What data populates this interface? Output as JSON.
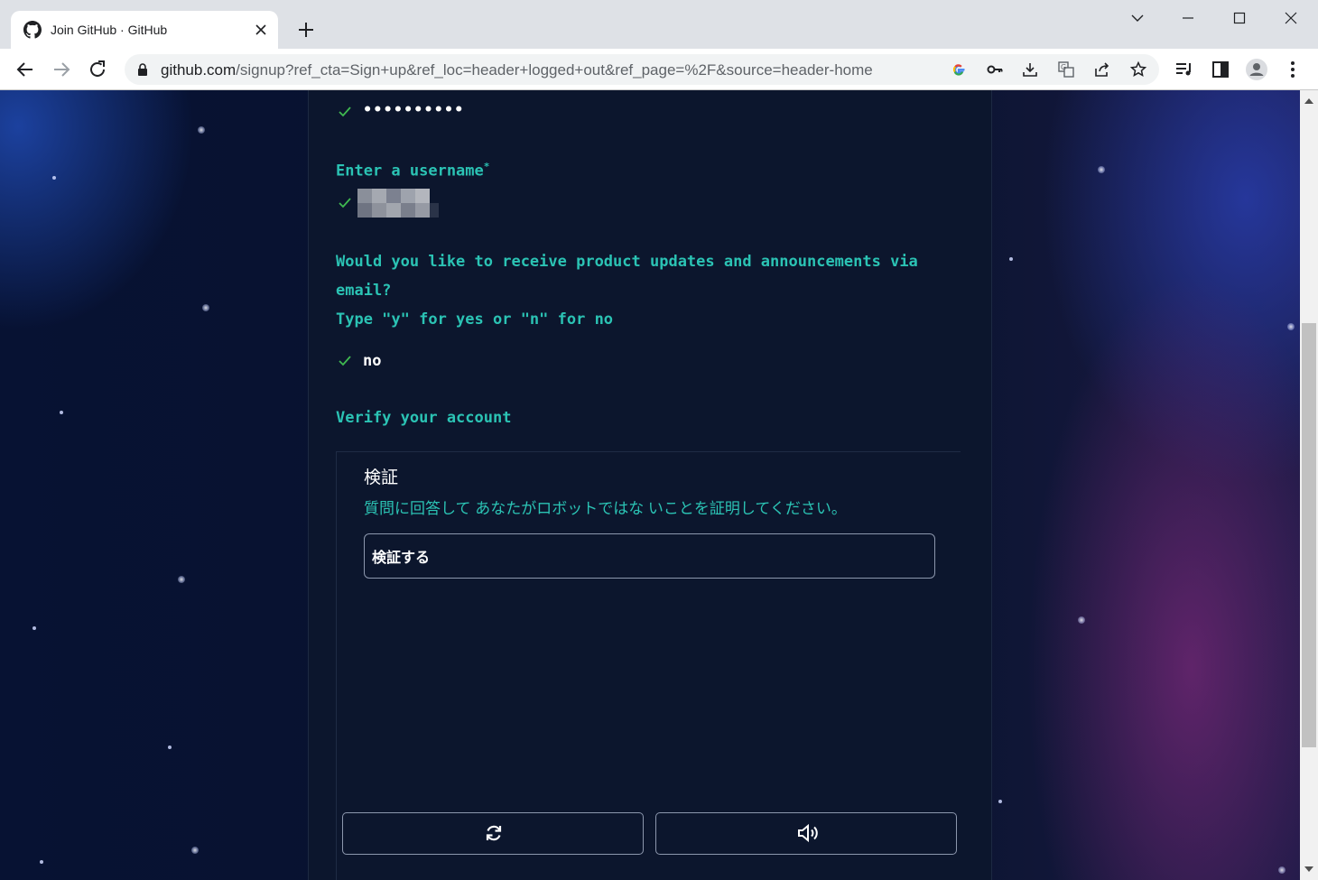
{
  "browser": {
    "tab_title": "Join GitHub · GitHub",
    "url_host": "github.com",
    "url_path": "/signup?ref_cta=Sign+up&ref_loc=header+logged+out&ref_page=%2F&source=header-home"
  },
  "form": {
    "password_value": "••••••••••",
    "username_label": "Enter a username",
    "username_required_mark": "*",
    "email_question_line1": "Would you like to receive product updates and announcements via",
    "email_question_line2": "email?",
    "email_question_line3": "Type \"y\" for yes or \"n\" for no",
    "email_answer": "no",
    "verify_heading": "Verify your account"
  },
  "captcha": {
    "title": "検証",
    "description": "質問に回答して あなたがロボットではな いことを証明してください。",
    "button_label": "検証する",
    "reload_icon": "reload-icon",
    "audio_icon": "speaker-icon"
  },
  "colors": {
    "accent_teal": "#2bc3b4",
    "check_green": "#3fb950",
    "card_bg": "#0c162d"
  }
}
